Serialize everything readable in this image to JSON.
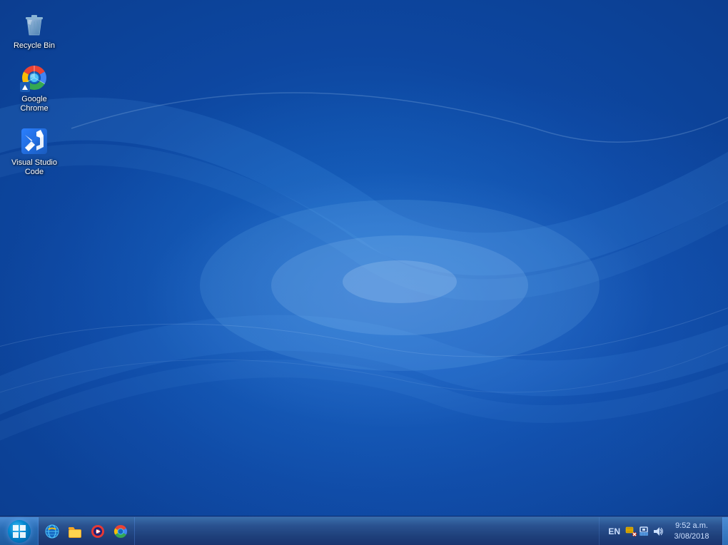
{
  "desktop": {
    "background_color": "#1a5cb5"
  },
  "icons": [
    {
      "id": "recycle-bin",
      "label": "Recycle Bin",
      "type": "recycle-bin"
    },
    {
      "id": "google-chrome",
      "label": "Google Chrome",
      "type": "chrome"
    },
    {
      "id": "visual-studio-code",
      "label": "Visual Studio Code",
      "type": "vscode"
    }
  ],
  "taskbar": {
    "quick_launch": [
      {
        "id": "ie",
        "label": "Internet Explorer"
      },
      {
        "id": "folder",
        "label": "Windows Explorer"
      },
      {
        "id": "media",
        "label": "Windows Media Player"
      },
      {
        "id": "chrome",
        "label": "Google Chrome"
      }
    ],
    "tray": {
      "language": "EN",
      "time": "9:52 a.m.",
      "date": "3/08/2018"
    }
  }
}
